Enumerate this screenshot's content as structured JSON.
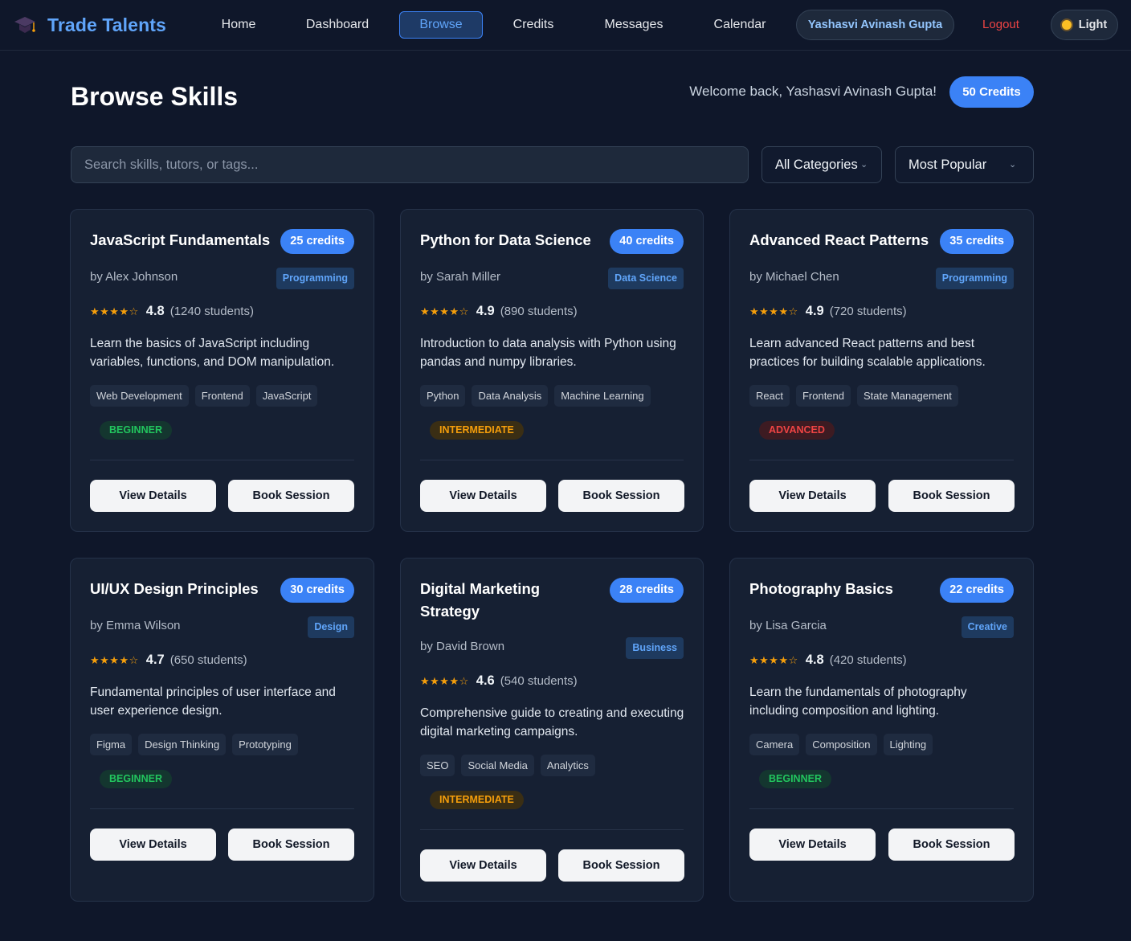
{
  "nav": {
    "brand": "Trade Talents",
    "links": [
      "Home",
      "Dashboard",
      "Browse",
      "Credits",
      "Messages",
      "Calendar"
    ],
    "active": "Browse",
    "user": "Yashasvi Avinash Gupta",
    "logout": "Logout",
    "theme": "Light"
  },
  "header": {
    "title": "Browse Skills",
    "welcome": "Welcome back, Yashasvi Avinash Gupta!",
    "credits": "50 Credits"
  },
  "filters": {
    "search_placeholder": "Search skills, tutors, or tags...",
    "category": "All Categories",
    "sort": "Most Popular"
  },
  "colors": {
    "accent": "#3b82f6",
    "background": "#0f172a",
    "card": "#162033",
    "beginner": "#22c55e",
    "intermediate": "#f59e0b",
    "advanced": "#ef4444"
  },
  "skills": [
    {
      "title": "JavaScript Fundamentals",
      "credits": "25 credits",
      "tutor": "by Alex Johnson",
      "category": "Programming",
      "stars": "★★★★☆",
      "rating": "4.8",
      "students": "(1240 students)",
      "description": "Learn the basics of JavaScript including variables, functions, and DOM manipulation.",
      "tags": [
        "Web Development",
        "Frontend",
        "JavaScript"
      ],
      "level": "BEGINNER",
      "view": "View Details",
      "book": "Book Session"
    },
    {
      "title": "Python for Data Science",
      "credits": "40 credits",
      "tutor": "by Sarah Miller",
      "category": "Data Science",
      "stars": "★★★★☆",
      "rating": "4.9",
      "students": "(890 students)",
      "description": "Introduction to data analysis with Python using pandas and numpy libraries.",
      "tags": [
        "Python",
        "Data Analysis",
        "Machine Learning"
      ],
      "level": "INTERMEDIATE",
      "view": "View Details",
      "book": "Book Session"
    },
    {
      "title": "Advanced React Patterns",
      "credits": "35 credits",
      "tutor": "by Michael Chen",
      "category": "Programming",
      "stars": "★★★★☆",
      "rating": "4.9",
      "students": "(720 students)",
      "description": "Learn advanced React patterns and best practices for building scalable applications.",
      "tags": [
        "React",
        "Frontend",
        "State Management"
      ],
      "level": "ADVANCED",
      "view": "View Details",
      "book": "Book Session"
    },
    {
      "title": "UI/UX Design Principles",
      "credits": "30 credits",
      "tutor": "by Emma Wilson",
      "category": "Design",
      "stars": "★★★★☆",
      "rating": "4.7",
      "students": "(650 students)",
      "description": "Fundamental principles of user interface and user experience design.",
      "tags": [
        "Figma",
        "Design Thinking",
        "Prototyping"
      ],
      "level": "BEGINNER",
      "view": "View Details",
      "book": "Book Session"
    },
    {
      "title": "Digital Marketing Strategy",
      "credits": "28 credits",
      "tutor": "by David Brown",
      "category": "Business",
      "stars": "★★★★☆",
      "rating": "4.6",
      "students": "(540 students)",
      "description": "Comprehensive guide to creating and executing digital marketing campaigns.",
      "tags": [
        "SEO",
        "Social Media",
        "Analytics"
      ],
      "level": "INTERMEDIATE",
      "view": "View Details",
      "book": "Book Session"
    },
    {
      "title": "Photography Basics",
      "credits": "22 credits",
      "tutor": "by Lisa Garcia",
      "category": "Creative",
      "stars": "★★★★☆",
      "rating": "4.8",
      "students": "(420 students)",
      "description": "Learn the fundamentals of photography including composition and lighting.",
      "tags": [
        "Camera",
        "Composition",
        "Lighting"
      ],
      "level": "BEGINNER",
      "view": "View Details",
      "book": "Book Session"
    }
  ]
}
